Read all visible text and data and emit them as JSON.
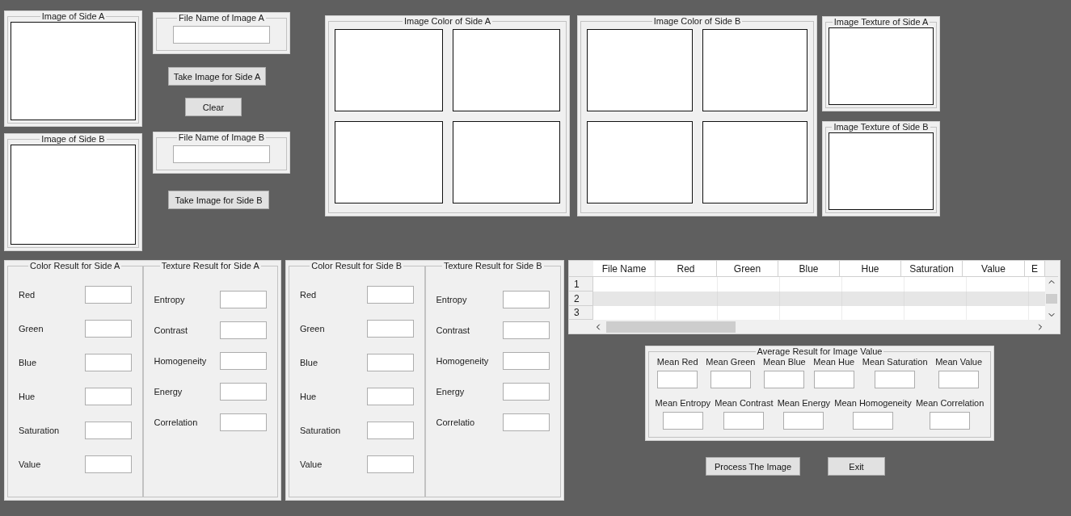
{
  "left": {
    "image_panels": [
      "Image of Side A",
      "Image of Side B"
    ],
    "file_name_panels": [
      "File Name of Image A",
      "File Name of Image B"
    ],
    "take_buttons": [
      "Take Image for Side A",
      "Take Image for Side B"
    ],
    "clear_button": "Clear"
  },
  "color_panels": [
    "Image Color of Side A",
    "Image Color of Side B"
  ],
  "texture_panels": [
    "Image Texture of Side A",
    "Image Texture of Side B"
  ],
  "result_groups": [
    {
      "color": {
        "title": "Color Result for Side A",
        "labels": [
          "Red",
          "Green",
          "Blue",
          "Hue",
          "Saturation",
          "Value"
        ]
      },
      "texture": {
        "title": "Texture Result for Side A",
        "labels": [
          "Entropy",
          "Contrast",
          "Homogeneity",
          "Energy",
          "Correlation"
        ]
      }
    },
    {
      "color": {
        "title": "Color Result for Side B",
        "labels": [
          "Red",
          "Green",
          "Blue",
          "Hue",
          "Saturation",
          "Value"
        ]
      },
      "texture": {
        "title": "Texture Result for Side B",
        "labels": [
          "Entropy",
          "Contrast",
          "Homogeneity",
          "Energy",
          "Correlatio"
        ]
      }
    }
  ],
  "table": {
    "columns": [
      "File Name",
      "Red",
      "Green",
      "Blue",
      "Hue",
      "Saturation",
      "Value",
      "E"
    ],
    "rows": [
      "1",
      "2",
      "3"
    ]
  },
  "average": {
    "title": "Average Result for Image Value",
    "row_1": [
      "Mean Red",
      "Mean Green",
      "Mean Blue",
      "Mean Hue",
      "Mean Saturation",
      "Mean Value"
    ],
    "row_2": [
      "Mean Entropy",
      "Mean Contrast",
      "Mean Energy",
      "Mean Homogeneity",
      "Mean Correlation"
    ]
  },
  "actions": [
    "Process The Image",
    "Exit"
  ]
}
